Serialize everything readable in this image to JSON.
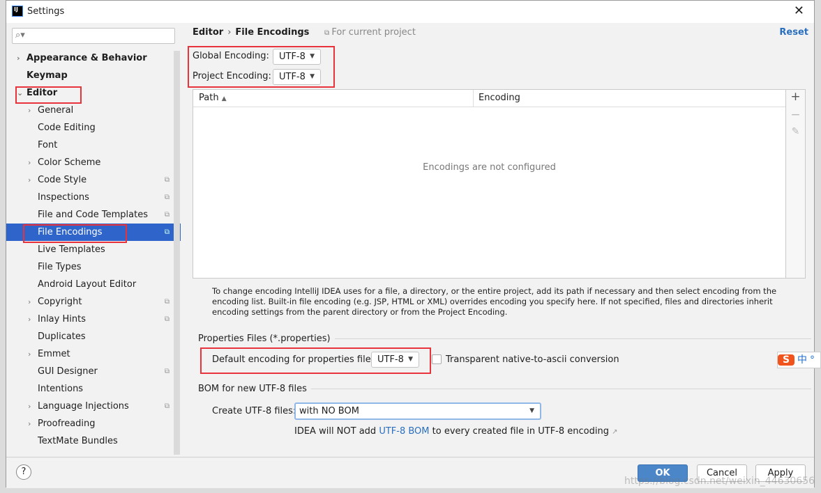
{
  "window": {
    "title": "Settings",
    "close": "✕"
  },
  "search": {
    "placeholder": "",
    "icon": "search-icon"
  },
  "tree": [
    {
      "label": "Appearance & Behavior",
      "level": 0,
      "bold": true,
      "arrow": "›"
    },
    {
      "label": "Keymap",
      "level": 0,
      "bold": true,
      "arrow": ""
    },
    {
      "label": "Editor",
      "level": 0,
      "bold": true,
      "arrow": "⌄"
    },
    {
      "label": "General",
      "level": 1,
      "arrow": "›"
    },
    {
      "label": "Code Editing",
      "level": 1,
      "arrow": ""
    },
    {
      "label": "Font",
      "level": 1,
      "arrow": ""
    },
    {
      "label": "Color Scheme",
      "level": 1,
      "arrow": "›"
    },
    {
      "label": "Code Style",
      "level": 1,
      "arrow": "›",
      "project": true
    },
    {
      "label": "Inspections",
      "level": 1,
      "arrow": "",
      "project": true
    },
    {
      "label": "File and Code Templates",
      "level": 1,
      "arrow": "",
      "project": true
    },
    {
      "label": "File Encodings",
      "level": 1,
      "arrow": "",
      "project": true,
      "selected": true
    },
    {
      "label": "Live Templates",
      "level": 1,
      "arrow": ""
    },
    {
      "label": "File Types",
      "level": 1,
      "arrow": ""
    },
    {
      "label": "Android Layout Editor",
      "level": 1,
      "arrow": ""
    },
    {
      "label": "Copyright",
      "level": 1,
      "arrow": "›",
      "project": true
    },
    {
      "label": "Inlay Hints",
      "level": 1,
      "arrow": "›",
      "project": true
    },
    {
      "label": "Duplicates",
      "level": 1,
      "arrow": ""
    },
    {
      "label": "Emmet",
      "level": 1,
      "arrow": "›"
    },
    {
      "label": "GUI Designer",
      "level": 1,
      "arrow": "",
      "project": true
    },
    {
      "label": "Intentions",
      "level": 1,
      "arrow": ""
    },
    {
      "label": "Language Injections",
      "level": 1,
      "arrow": "›",
      "project": true
    },
    {
      "label": "Proofreading",
      "level": 1,
      "arrow": "›"
    },
    {
      "label": "TextMate Bundles",
      "level": 1,
      "arrow": ""
    }
  ],
  "header": {
    "crumb1": "Editor",
    "sep": "›",
    "crumb2": "File Encodings",
    "for_project": "For current project",
    "reset": "Reset"
  },
  "encodings": {
    "global_label": "Global Encoding:",
    "global_value": "UTF-8",
    "project_label": "Project Encoding:",
    "project_value": "UTF-8"
  },
  "table": {
    "col_path": "Path",
    "sort": "▲",
    "col_encoding": "Encoding",
    "empty": "Encodings are not configured",
    "tools": [
      "+",
      "−",
      "✎"
    ]
  },
  "description": "To change encoding IntelliJ IDEA uses for a file, a directory, or the entire project, add its path if necessary and then select encoding from the encoding list. Built-in file encoding (e.g. JSP, HTML or XML) overrides encoding you specify here. If not specified, files and directories inherit encoding settings from the parent directory or from the Project Encoding.",
  "properties": {
    "section": "Properties Files (*.properties)",
    "default_label": "Default encoding for properties files:",
    "default_value": "UTF-8",
    "transparent_label": "Transparent native-to-ascii conversion",
    "transparent_checked": false
  },
  "bom": {
    "section": "BOM for new UTF-8 files",
    "create_label": "Create UTF-8 files:",
    "create_value": "with NO BOM",
    "note_pre": "IDEA will NOT add ",
    "note_link": "UTF-8 BOM",
    "note_post": " to every created file in UTF-8 encoding",
    "note_icon": "↗"
  },
  "buttons": {
    "help": "?",
    "ok": "OK",
    "cancel": "Cancel",
    "apply": "Apply"
  },
  "ime": {
    "s": "S",
    "lang": "中",
    "dot": "°"
  },
  "watermark": "https://blog.csdn.net/weixin_44630656",
  "colors": {
    "selection": "#2f65ca",
    "highlight_box": "#e8323c",
    "link": "#2a6fbe",
    "ok": "#4a86c8"
  }
}
